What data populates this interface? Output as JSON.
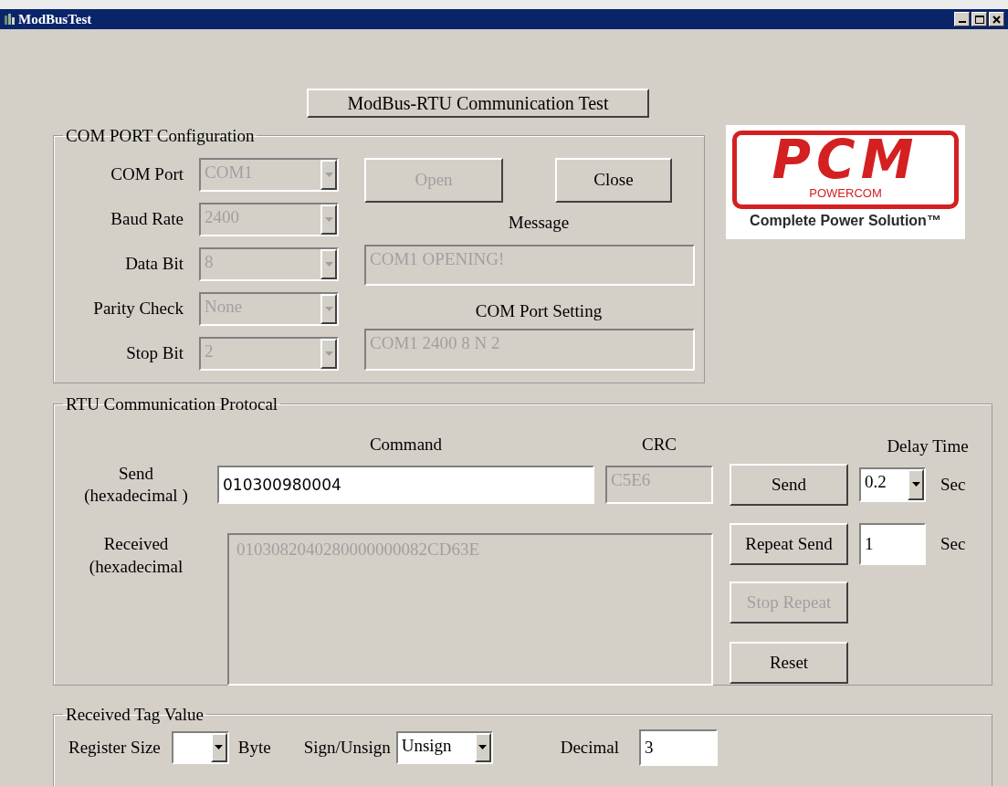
{
  "window": {
    "title": "ModBusTest"
  },
  "header_button": {
    "label": "ModBus-RTU Communication Test"
  },
  "com_port_configuration": {
    "title": "COM PORT Configuration",
    "fields": [
      {
        "label": "COM Port",
        "value": "COM1",
        "disabled": true
      },
      {
        "label": "Baud Rate",
        "value": "2400",
        "disabled": true
      },
      {
        "label": "Data Bit",
        "value": "8",
        "disabled": true
      },
      {
        "label": "Parity Check",
        "value": "None",
        "disabled": true
      },
      {
        "label": "Stop Bit",
        "value": "2",
        "disabled": true
      }
    ],
    "buttons": [
      {
        "label": "Open",
        "disabled": true
      },
      {
        "label": "Close",
        "disabled": false
      }
    ],
    "message": {
      "label": "Message",
      "value": "COM1 OPENING!",
      "disabled": true
    },
    "setting": {
      "label": "COM Port Setting",
      "value": "COM1 2400 8 N 2",
      "disabled": true
    }
  },
  "logo": {
    "mark": "PCM",
    "brand": "POWERCOM",
    "tagline": "Complete Power Solution™"
  },
  "rtu_communication": {
    "title": "RTU Communication Protocal",
    "command_label": "Command",
    "crc_label": "CRC",
    "delay_label": "Delay Time",
    "send_label": "Send\n(hexadecimal )",
    "command_value": "010300980004",
    "crc_value": "C5E6",
    "received_label": "Received\n(hexadecimal",
    "received_value": "0103082040280000000082CD63E",
    "delay": {
      "value": "0.2",
      "unit": "Sec"
    },
    "repeat_interval": {
      "value": "1",
      "unit": "Sec"
    },
    "buttons": [
      {
        "label": "Send",
        "disabled": false
      },
      {
        "label": "Repeat Send",
        "disabled": false
      },
      {
        "label": "Stop Repeat",
        "disabled": true
      },
      {
        "label": "Reset",
        "disabled": false
      }
    ]
  },
  "received_tag_value": {
    "title": "Received Tag Value",
    "register_size": {
      "label": "Register Size",
      "unit": "Byte"
    },
    "sign": {
      "label": "Sign/Unsign",
      "value": "Unsign"
    },
    "decimal": {
      "label": "Decimal",
      "value": "3"
    }
  }
}
